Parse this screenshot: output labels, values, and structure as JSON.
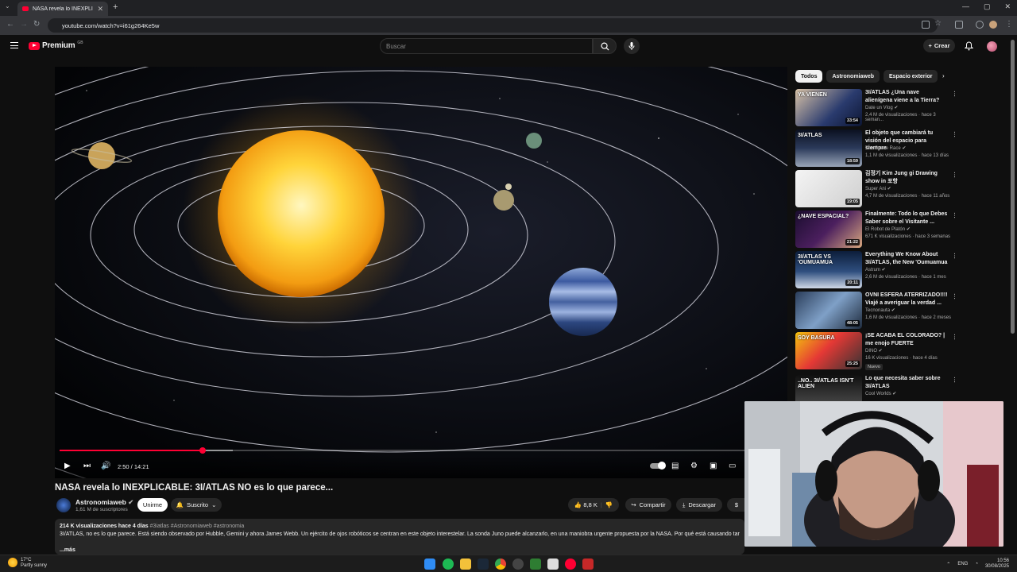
{
  "browser": {
    "tab_title": "NASA revela lo INEXPLICABLE:",
    "url": "youtube.com/watch?v=i61g264Ke5w"
  },
  "header": {
    "logo_text": "Premium",
    "logo_sup": "GB",
    "search_placeholder": "Buscar",
    "create_label": "Crear"
  },
  "player": {
    "time": "2:50 / 14:21",
    "progress_fraction": 0.198,
    "buffer_fraction": 0.24
  },
  "video": {
    "title": "NASA revela lo INEXPLICABLE: 3I/ATLAS NO es lo que parece...",
    "channel": "Astronomiaweb",
    "subscribers": "1,61 M de suscriptores",
    "join_label": "Unirme",
    "subscribed_label": "Suscrito",
    "likes": "8,8 K",
    "share_label": "Compartir",
    "download_label": "Descargar"
  },
  "description": {
    "stats": "214 K visualizaciones  hace 4 días",
    "tags": "#3iatlas #Astronomiaweb #astronomia",
    "text": "3I/ATLAS, no es lo que parece. Está siendo observado por Hubble, Gemini y ahora James Webb. Un ejército de ojos robóticos se centran en este objeto interestelar. La sonda Juno puede alcanzarlo, en una maniobra urgente propuesta por la NASA. Por qué está causando tanto re",
    "more": "...más"
  },
  "chips": [
    "Todos",
    "Astronomiaweb",
    "Espacio exterior"
  ],
  "recommendations": [
    {
      "title": "3I/ATLAS ¿Una nave alienígena viene a la Tierra?",
      "channel": "Date un Vlog",
      "meta": "2,4 M de visualizaciones · hace 3 seman...",
      "duration": "33:54",
      "thumb_text": "YA VIENEN"
    },
    {
      "title": "El objeto que cambiará tu visión del espacio para siempre",
      "channel": "The Space Race",
      "meta": "1,1 M de visualizaciones · hace 13 días",
      "duration": "18:59",
      "thumb_text": "3I/ATLAS"
    },
    {
      "title": "김정기 Kim Jung gi Drawing show in 포항",
      "channel": "Super Ani",
      "meta": "4,7 M de visualizaciones · hace 11 años",
      "duration": "19:05",
      "thumb_text": ""
    },
    {
      "title": "Finalmente: Todo lo que Debes Saber sobre el Visitante ...",
      "channel": "El Robot de Platón",
      "meta": "671 K visualizaciones · hace 3 semanas",
      "duration": "21:22",
      "thumb_text": "¿NAVE ESPACIAL?"
    },
    {
      "title": "Everything We Know About 3I/ATLAS, the New 'Oumuamua",
      "channel": "Astrum",
      "meta": "2,6 M de visualizaciones · hace 1 mes",
      "duration": "20:11",
      "thumb_text": "3I/ATLAS VS 'OUMUAMUA"
    },
    {
      "title": "OVNI ESFERA ATERRIZADO!!!! Viajé a averiguar la verdad ...",
      "channel": "Tecnonauta",
      "meta": "1,6 M de visualizaciones · hace 2 meses",
      "duration": "48:05",
      "thumb_text": ""
    },
    {
      "title": "¡SE ACABA EL COLORADO? | me enojo FUERTE",
      "channel": "DINO",
      "meta": "16 K visualizaciones · hace 4 días",
      "duration": "25:25",
      "thumb_text": "SOY BASURA",
      "badge": "Nuevo"
    },
    {
      "title": "Lo que necesita saber sobre 3I/ATLAS",
      "channel": "Cool Worlds",
      "meta": "",
      "duration": "",
      "thumb_text": "..NO.. 3I/ATLAS ISN'T ALIEN"
    }
  ],
  "taskbar": {
    "temp": "17°C",
    "weather": "Partly sunny",
    "lang": "ENG",
    "time": "10:56",
    "date": "30/08/2025"
  }
}
